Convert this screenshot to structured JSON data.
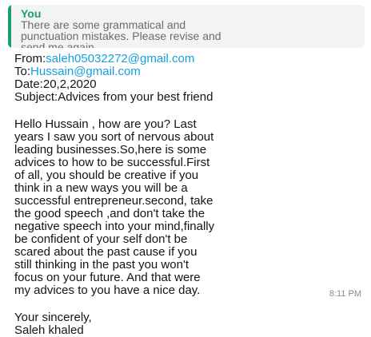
{
  "reply": {
    "author": "You",
    "lines": [
      "There are some grammatical and",
      "punctuation mistakes. Please revise and",
      "send me again."
    ]
  },
  "email": {
    "from_label": "From:",
    "from_email": "saleh05032272@gmail.com",
    "to_label": "To:",
    "to_email": "Hussain@gmail.com",
    "date": "Date:20,2,2020",
    "subject": "Subject:Advices from your best friend",
    "body_lines": [
      "Hello Hussain , how are you? Last",
      "years I saw you sort of nervous about",
      "leading businesses.So,here is some",
      "advices to how to be successful.First",
      "of all, you should be creative if you",
      "think in a new ways you will be a",
      "successful entrepreneur.second, take",
      "the good speech ,and don't take the",
      "negative speech into your mind,finally",
      "be confident of your  self don't be",
      "scared about the past cause if you",
      "still thinking in the past you won't",
      "focus on your future. And that were",
      "my advices to you have a nice day."
    ],
    "closing": "Your sincerely,",
    "signature": "Saleh khaled"
  },
  "time": "8:11 PM",
  "colors": {
    "accent_green": "#1f9b72",
    "link_blue": "#16a0dd",
    "quote_bg": "#f2f3f3"
  }
}
